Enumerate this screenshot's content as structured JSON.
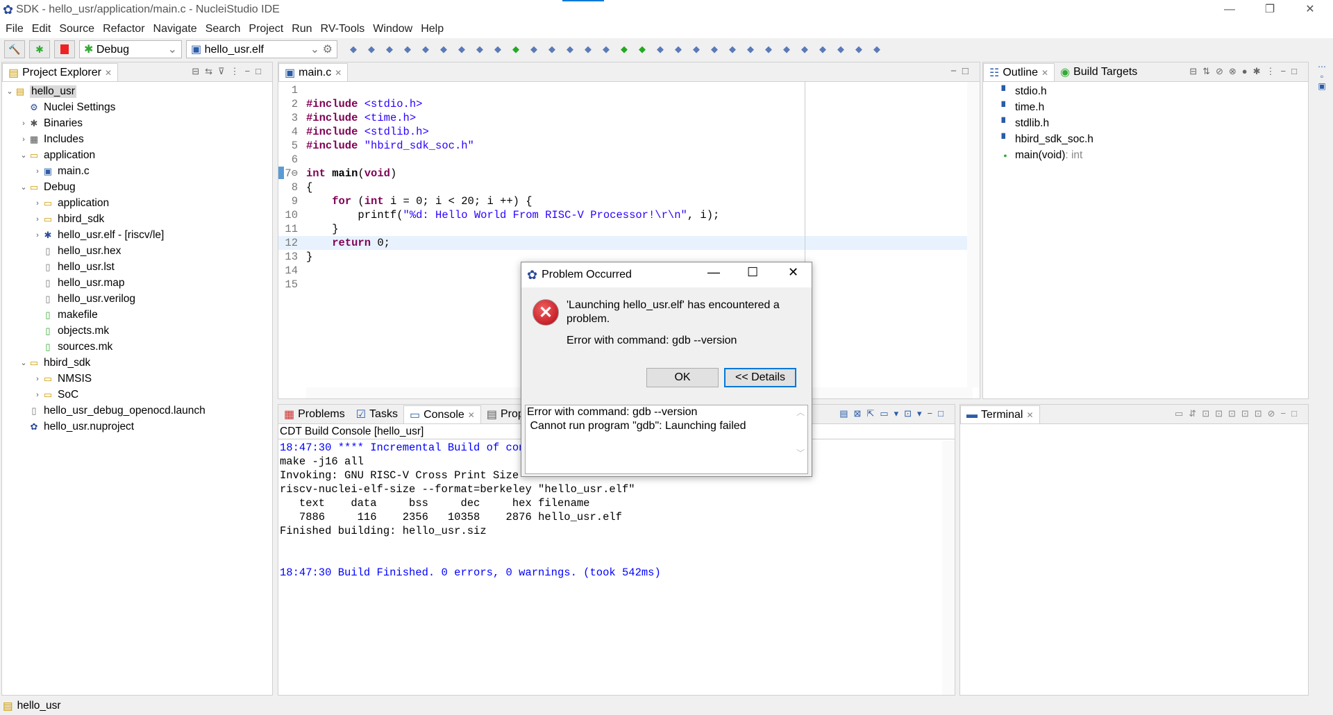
{
  "window": {
    "title": "SDK - hello_usr/application/main.c - NucleiStudio IDE",
    "minimize": "—",
    "restore": "❐",
    "close": "✕"
  },
  "menu": [
    "File",
    "Edit",
    "Source",
    "Refactor",
    "Navigate",
    "Search",
    "Project",
    "Run",
    "RV-Tools",
    "Window",
    "Help"
  ],
  "toolbar": {
    "mode": "Debug",
    "launch_target": "hello_usr.elf"
  },
  "project_explorer": {
    "title": "Project Explorer",
    "items": [
      {
        "label": "hello_usr",
        "depth": 0,
        "tw": "v",
        "icon": "project-icon",
        "selected": true
      },
      {
        "label": "Nuclei Settings",
        "depth": 1,
        "tw": "",
        "icon": "settings-icon"
      },
      {
        "label": "Binaries",
        "depth": 1,
        "tw": ">",
        "icon": "binaries-icon"
      },
      {
        "label": "Includes",
        "depth": 1,
        "tw": ">",
        "icon": "includes-icon"
      },
      {
        "label": "application",
        "depth": 1,
        "tw": "v",
        "icon": "folder-icon"
      },
      {
        "label": "main.c",
        "depth": 2,
        "tw": ">",
        "icon": "c-file-icon"
      },
      {
        "label": "Debug",
        "depth": 1,
        "tw": "v",
        "icon": "folder-icon"
      },
      {
        "label": "application",
        "depth": 2,
        "tw": ">",
        "icon": "folder-icon"
      },
      {
        "label": "hbird_sdk",
        "depth": 2,
        "tw": ">",
        "icon": "folder-icon"
      },
      {
        "label": "hello_usr.elf - [riscv/le]",
        "depth": 2,
        "tw": ">",
        "icon": "binary-icon"
      },
      {
        "label": "hello_usr.hex",
        "depth": 2,
        "tw": "",
        "icon": "file-icon"
      },
      {
        "label": "hello_usr.lst",
        "depth": 2,
        "tw": "",
        "icon": "file-icon"
      },
      {
        "label": "hello_usr.map",
        "depth": 2,
        "tw": "",
        "icon": "file-icon"
      },
      {
        "label": "hello_usr.verilog",
        "depth": 2,
        "tw": "",
        "icon": "file-icon"
      },
      {
        "label": "makefile",
        "depth": 2,
        "tw": "",
        "icon": "makefile-icon"
      },
      {
        "label": "objects.mk",
        "depth": 2,
        "tw": "",
        "icon": "makefile-icon"
      },
      {
        "label": "sources.mk",
        "depth": 2,
        "tw": "",
        "icon": "makefile-icon"
      },
      {
        "label": "hbird_sdk",
        "depth": 1,
        "tw": "v",
        "icon": "folder-icon"
      },
      {
        "label": "NMSIS",
        "depth": 2,
        "tw": ">",
        "icon": "folder-icon"
      },
      {
        "label": "SoC",
        "depth": 2,
        "tw": ">",
        "icon": "folder-icon"
      },
      {
        "label": "hello_usr_debug_openocd.launch",
        "depth": 1,
        "tw": "",
        "icon": "file-icon"
      },
      {
        "label": "hello_usr.nuproject",
        "depth": 1,
        "tw": "",
        "icon": "nuclei-icon"
      }
    ]
  },
  "editor": {
    "tab": "main.c",
    "lines": [
      "",
      "#include <stdio.h>",
      "#include <time.h>",
      "#include <stdlib.h>",
      "#include \"hbird_sdk_soc.h\"",
      "",
      "int main(void)",
      "{",
      "    for (int i = 0; i < 20; i ++) {",
      "        printf(\"%d: Hello World From RISC-V Processor!\\r\\n\", i);",
      "    }",
      "    return 0;",
      "}",
      "",
      ""
    ]
  },
  "outline": {
    "tabs": [
      "Outline",
      "Build Targets"
    ],
    "items": [
      {
        "label": "stdio.h",
        "type": ""
      },
      {
        "label": "time.h",
        "type": ""
      },
      {
        "label": "stdlib.h",
        "type": ""
      },
      {
        "label": "hbird_sdk_soc.h",
        "type": ""
      },
      {
        "label": "main(void)",
        "type": " : int"
      }
    ]
  },
  "bottom": {
    "tabs": [
      "Problems",
      "Tasks",
      "Console",
      "Properties"
    ],
    "console_title": "CDT Build Console [hello_usr]",
    "lines": [
      {
        "t": "18:47:30 **** Incremental Build of configuration Debug for project hello_usr ****",
        "blue": true
      },
      {
        "t": "make -j16 all",
        "blue": false
      },
      {
        "t": "Invoking: GNU RISC-V Cross Print Size",
        "blue": false
      },
      {
        "t": "riscv-nuclei-elf-size --format=berkeley \"hello_usr.elf\"",
        "blue": false
      },
      {
        "t": "   text\t   data\t    bss\t    dec\t    hex\tfilename",
        "blue": false
      },
      {
        "t": "   7886\t    116\t   2356\t  10358\t   2876\thello_usr.elf",
        "blue": false
      },
      {
        "t": "Finished building: hello_usr.siz",
        "blue": false
      },
      {
        "t": "",
        "blue": false
      },
      {
        "t": "",
        "blue": false
      },
      {
        "t": "18:47:30 Build Finished. 0 errors, 0 warnings. (took 542ms)",
        "blue": true
      }
    ]
  },
  "terminal": {
    "tab": "Terminal"
  },
  "status": {
    "selection": "hello_usr"
  },
  "dialog": {
    "title": "Problem Occurred",
    "message": "'Launching hello_usr.elf' has encountered a problem.",
    "detail": "Error with command: gdb --version",
    "ok": "OK",
    "details": "<< Details",
    "details_text": "Error with command: gdb --version\n Cannot run program \"gdb\": Launching failed"
  },
  "colors": {
    "accent": "#0078d7",
    "keyword": "#7f0055",
    "string": "#2a00ff",
    "console_blue": "#0000ff",
    "error": "#c8202a"
  }
}
